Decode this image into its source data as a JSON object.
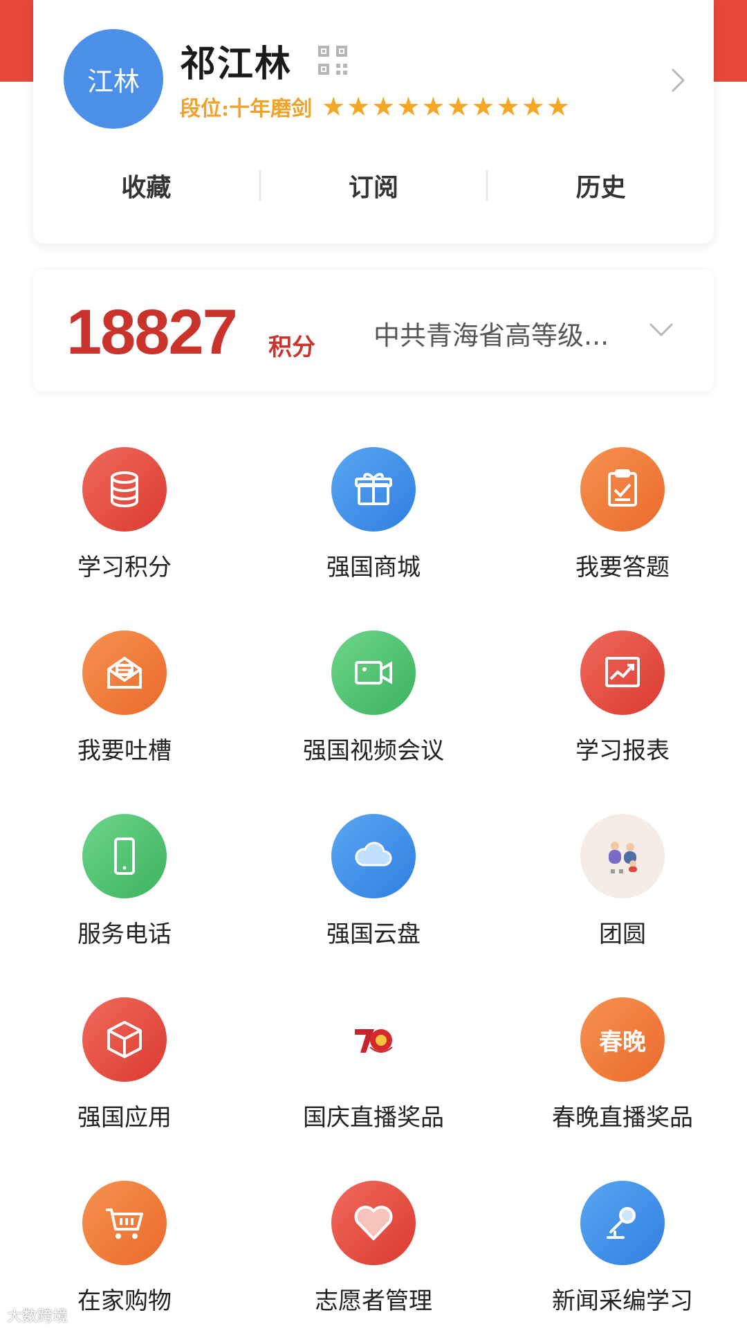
{
  "profile": {
    "avatar_text": "江林",
    "name": "祁江林",
    "rank_label": "段位:十年磨剑",
    "stars": 10,
    "tabs": [
      "收藏",
      "订阅",
      "历史"
    ]
  },
  "points": {
    "value": "18827",
    "unit": "积分",
    "organization": "中共青海省高等级..."
  },
  "grid": [
    {
      "label": "学习积分",
      "icon": "database-icon"
    },
    {
      "label": "强国商城",
      "icon": "gift-icon"
    },
    {
      "label": "我要答题",
      "icon": "clipboard-check-icon"
    },
    {
      "label": "我要吐槽",
      "icon": "envelope-icon"
    },
    {
      "label": "强国视频会议",
      "icon": "video-camera-icon"
    },
    {
      "label": "学习报表",
      "icon": "chart-report-icon"
    },
    {
      "label": "服务电话",
      "icon": "phone-icon"
    },
    {
      "label": "强国云盘",
      "icon": "cloud-icon"
    },
    {
      "label": "团圆",
      "icon": "reunion-illustration-icon"
    },
    {
      "label": "强国应用",
      "icon": "cube-icon"
    },
    {
      "label": "国庆直播奖品",
      "icon": "anniversary-70-logo"
    },
    {
      "label": "春晚直播奖品",
      "icon": "spring-gala-badge",
      "badge_text": "春晚"
    },
    {
      "label": "在家购物",
      "icon": "shopping-cart-icon"
    },
    {
      "label": "志愿者管理",
      "icon": "heart-icon"
    },
    {
      "label": "新闻采编学习",
      "icon": "microphone-icon"
    }
  ],
  "watermark": "大数跨境",
  "colors": {
    "brand_red": "#e8473a",
    "points_red": "#c9332c",
    "rank_gold": "#f0a12a",
    "avatar_blue": "#4b8fe8"
  }
}
